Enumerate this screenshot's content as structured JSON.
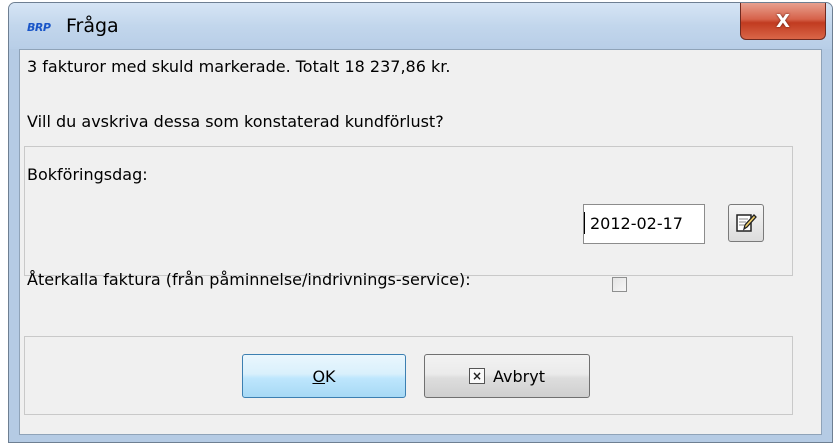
{
  "window": {
    "app_logo": "BRP",
    "title": "Fråga",
    "close_symbol": "X"
  },
  "message": {
    "line1": "3 fakturor med skuld markerade. Totalt 18 237,86 kr.",
    "line2": "Vill du avskriva dessa som konstaterad kundförlust?"
  },
  "form": {
    "date_label": "Bokföringsdag:",
    "date_value": "2012-02-17",
    "date_button_icon": "edit-calendar-icon",
    "recall_label": "Återkalla faktura (från påminnelse/indrivnings-service):",
    "recall_checked": false
  },
  "buttons": {
    "ok_mnemonic": "O",
    "ok_rest": "K",
    "cancel_icon": "x-box-icon",
    "cancel_symbol": "×",
    "cancel_label": "Avbryt"
  },
  "colors": {
    "titlebar": "#c2d6ec",
    "close_button": "#c13b20",
    "ok_button": "#bee6fd",
    "dialog_background": "#f0f0f0"
  }
}
